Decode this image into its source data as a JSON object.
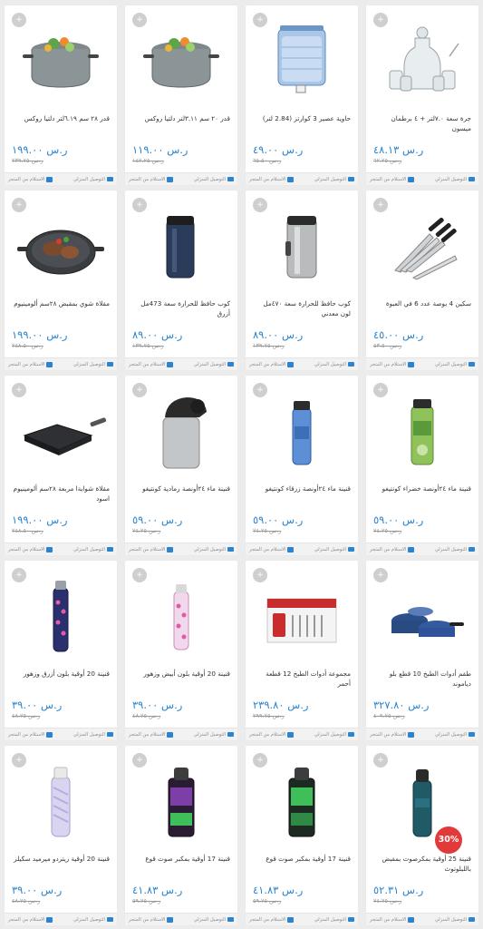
{
  "labels": {
    "delivery": "التوصيل المنزلي",
    "pickup": "الاستلام من المتجر"
  },
  "colors": {
    "price": "#2a84cf",
    "discount_badge": "#e23a3a",
    "footer_icon": "#2a84cf"
  },
  "products": [
    {
      "title": "جرة سعة ٧.٠لتر + ٤ برطمان ميسون",
      "price": "ر.س ٤٨.١٣",
      "old_price": "ر.س ٦٢.٢٥",
      "icon": "glass-jar-set-icon",
      "discount": ""
    },
    {
      "title": "حاوية عصير 3 كوارتز (2.84 لتر)",
      "price": "ر.س ٤٩.٠٠",
      "old_price": "ر.س ٦٥.٥٠",
      "icon": "juice-dispenser-icon",
      "discount": ""
    },
    {
      "title": "قدر ٢٠ سم ٣.١١لتر دلتيا روكس",
      "price": "ر.س ١١٩.٠٠",
      "old_price": "ر.س ١٤٢.٢٥",
      "icon": "cooking-pot-icon",
      "discount": ""
    },
    {
      "title": "قدر ٢٨ سم ٦.١٩لتر دلتيا روكس",
      "price": "ر.س ١٩٩.٠٠",
      "old_price": "ر.س ٢٣٩.٧٥",
      "icon": "cooking-pot-icon",
      "discount": ""
    },
    {
      "title": "سكين 4 بوصة عدد 6 في العبوة",
      "price": "ر.س ٤٥.٠٠",
      "old_price": "ر.س ٥٣.٥٠",
      "icon": "knife-set-icon",
      "discount": ""
    },
    {
      "title": "كوب حافظ للحرارة سعة ٤٧٠مل لون معدني",
      "price": "ر.س ٨٩.٠٠",
      "old_price": "ر.س ١٣٩.٧٥",
      "icon": "steel-tumbler-icon",
      "discount": ""
    },
    {
      "title": "كوب حافظ للحرارة سعة 473مل أزرق",
      "price": "ر.س ٨٩.٠٠",
      "old_price": "ر.س ١٣٩.٧٥",
      "icon": "blue-tumbler-icon",
      "discount": ""
    },
    {
      "title": "مقلاة شوي بمقبض ٢٨سم ألومينيوم",
      "price": "ر.س ١٩٩.٠٠",
      "old_price": "ر.س ٢٤٨.٥٠",
      "icon": "grill-pan-icon",
      "discount": ""
    },
    {
      "title": "قنينة ماء ٢٤أونصة خضراء كونتيغو",
      "price": "ر.س ٥٩.٠٠",
      "old_price": "ر.س ٧٤.٢٥",
      "icon": "green-bottle-icon",
      "discount": ""
    },
    {
      "title": "قنينة ماء ٢٤أونصة زرقاء كونتيغو",
      "price": "ر.س ٥٩.٠٠",
      "old_price": "ر.س ٧٤.٢٥",
      "icon": "blue-bottle-icon",
      "discount": ""
    },
    {
      "title": "قنينة ماء ٢٤أونصة رمادية كونتيغو",
      "price": "ر.س ٥٩.٠٠",
      "old_price": "ر.س ٧٤.٢٥",
      "icon": "grey-bottle-icon",
      "discount": ""
    },
    {
      "title": "مقلاة شوايةا مربعة ٢٨سم ألومينيوم اسود",
      "price": "ر.س ١٩٩.٠٠",
      "old_price": "ر.س ٢٤٨.٥٠",
      "icon": "square-pan-icon",
      "discount": ""
    },
    {
      "title": "طقم أدوات الطبخ 10 قطع بلو دياموند",
      "price": "ر.س ٣٢٧.٨٠",
      "old_price": "ر.س ٤٠٩.٧٥",
      "icon": "cookware-set-icon",
      "discount": ""
    },
    {
      "title": "مجموعة أدوات الطبخ 12 قطعة أحمر",
      "price": "ر.س ٢٣٩.٨٠",
      "old_price": "ر.س ٢٩٩.٧٥",
      "icon": "utensil-box-icon",
      "discount": ""
    },
    {
      "title": "قنينة 20 أوقية بلون أبيض وزهور",
      "price": "ر.س ٣٩.٠٠",
      "old_price": "ر.س ٤٨.٧٥",
      "icon": "floral-white-bottle-icon",
      "discount": ""
    },
    {
      "title": "قنينة 20 أوقية بلون أزرق وزهور",
      "price": "ر.س ٣٩.٠٠",
      "old_price": "ر.س ٤٨.٧٥",
      "icon": "floral-blue-bottle-icon",
      "discount": ""
    },
    {
      "title": "قنينة 25 أوقية بمكرصوت بمقبض باللبلوتوث",
      "price": "ر.س ٥٢.٣١",
      "old_price": "ر.س ٧٤.٧٥",
      "icon": "teal-bottle-icon",
      "discount": "30%"
    },
    {
      "title": "قنينة 17 أوقية بمكبر صوت قوع",
      "price": "ر.س ٤١.٨٣",
      "old_price": "ر.س ٥٩.٧٥",
      "icon": "speaker-bottle-green-icon",
      "discount": ""
    },
    {
      "title": "قنينة 17 أوقية بمكبر صوت قوع",
      "price": "ر.س ٤١.٨٣",
      "old_price": "ر.س ٥٩.٧٥",
      "icon": "speaker-bottle-purple-icon",
      "discount": ""
    },
    {
      "title": "قنينة 20 أوقية ريتردو ميرميد سكيلز",
      "price": "ر.س ٣٩.٠٠",
      "old_price": "ر.س ٤٨.٧٥",
      "icon": "pastel-bottle-icon",
      "discount": ""
    }
  ]
}
